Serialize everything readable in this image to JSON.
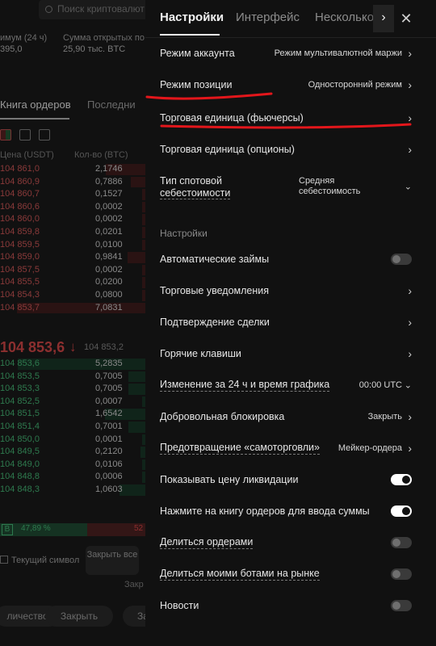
{
  "background": {
    "search_placeholder": "Поиск криптовалют",
    "stats": [
      {
        "label": "имум (24 ч)",
        "value": "395,0"
      },
      {
        "label": "Сумма открытых по",
        "value": "25,90 тыс. BTC"
      }
    ],
    "tabs": {
      "orderbook": "Книга ордеров",
      "recent": "Последни"
    },
    "columns": {
      "price": "Цена (USDT)",
      "qty": "Кол-во (BTC)"
    },
    "asks": [
      {
        "price": "104 861,0",
        "qty": "2,1746"
      },
      {
        "price": "104 860,9",
        "qty": "0,7886"
      },
      {
        "price": "104 860,7",
        "qty": "0,1527"
      },
      {
        "price": "104 860,6",
        "qty": "0,0002"
      },
      {
        "price": "104 860,0",
        "qty": "0,0002"
      },
      {
        "price": "104 859,8",
        "qty": "0,0201"
      },
      {
        "price": "104 859,5",
        "qty": "0,0100"
      },
      {
        "price": "104 859,0",
        "qty": "0,9841"
      },
      {
        "price": "104 857,5",
        "qty": "0,0002"
      },
      {
        "price": "104 855,5",
        "qty": "0,0200"
      },
      {
        "price": "104 854,3",
        "qty": "0,0800"
      },
      {
        "price": "104 853,7",
        "qty": "7,0831"
      }
    ],
    "last_price": "104 853,6",
    "mark_price": "104 853,2",
    "bids": [
      {
        "price": "104 853,6",
        "qty": "5,2835"
      },
      {
        "price": "104 853,5",
        "qty": "0,7005"
      },
      {
        "price": "104 853,3",
        "qty": "0,7005"
      },
      {
        "price": "104 852,5",
        "qty": "0,0007"
      },
      {
        "price": "104 851,5",
        "qty": "1,6542"
      },
      {
        "price": "104 851,4",
        "qty": "0,7001"
      },
      {
        "price": "104 850,0",
        "qty": "0,0001"
      },
      {
        "price": "104 849,5",
        "qty": "0,2120"
      },
      {
        "price": "104 849,0",
        "qty": "0,0106"
      },
      {
        "price": "104 848,8",
        "qty": "0,0006"
      },
      {
        "price": "104 848,3",
        "qty": "1,0603"
      }
    ],
    "ratio_badge": "B",
    "ratio_buy": "47,89 %",
    "ratio_sell": "52",
    "current_symbol": "Текущий символ",
    "close_all": "Закрыть все",
    "separator_text": "Закр",
    "btn_left": "личество",
    "btn_close": "Закрыть",
    "btn_right": "За"
  },
  "tabs": [
    {
      "label": "Настройки",
      "active": true
    },
    {
      "label": "Интерфейс",
      "active": false
    },
    {
      "label": "Несколько",
      "active": false
    }
  ],
  "settings": [
    {
      "label": "Режим аккаунта",
      "value": "Режим мультивалютной маржи"
    },
    {
      "label": "Режим позиции",
      "value": "Односторонний режим"
    },
    {
      "label": "Торговая единица (фьючерсы)",
      "value": ""
    },
    {
      "label": "Торговая единица (опционы)",
      "value": ""
    }
  ],
  "spot_cost": {
    "label_l1": "Тип спотовой",
    "label_l2": "себестоимости",
    "value_l1": "Средняя",
    "value_l2": "себестоимость"
  },
  "section_title": "Настройки",
  "prefs": [
    {
      "label": "Автоматические займы",
      "kind": "toggle",
      "on": false
    },
    {
      "label": "Торговые уведомления",
      "kind": "chevron"
    },
    {
      "label": "Подтверждение сделки",
      "kind": "chevron"
    },
    {
      "label": "Горячие клавиши",
      "kind": "chevron"
    },
    {
      "label": "Изменение за 24 ч и время графика",
      "kind": "dropdown",
      "value": "00:00 UTC"
    },
    {
      "label": "Добровольная блокировка",
      "kind": "chevron",
      "value": "Закрыть"
    },
    {
      "label": "Предотвращение «самоторговли»",
      "kind": "chevron",
      "value": "Мейкер-ордера"
    },
    {
      "label": "Показывать цену ликвидации",
      "kind": "toggle",
      "on": true
    },
    {
      "label": "Нажмите на книгу ордеров для ввода суммы",
      "kind": "toggle",
      "on": true
    },
    {
      "label": "Делиться ордерами",
      "kind": "toggle",
      "on": false
    },
    {
      "label": "Делиться моими ботами на рынке",
      "kind": "toggle",
      "on": false
    },
    {
      "label": "Новости",
      "kind": "toggle",
      "on": false
    }
  ],
  "colors": {
    "annotation": "#e3161b",
    "ask": "#8c2f2f",
    "bid": "#2e7a4e",
    "panel_bg": "#111111"
  }
}
